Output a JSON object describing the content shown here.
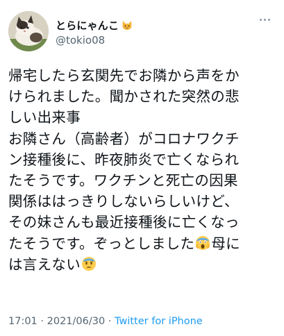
{
  "user": {
    "display_name": "とらにゃんこ",
    "handle": "@tokio08",
    "badge_icon": "cat-face-emoji",
    "avatar": "cat-photo-avatar"
  },
  "more_icon": "more-horizontal-icon",
  "tweet": {
    "lines": [
      "帰宅したら玄関先でお隣から声をか",
      "けられました。聞かされた突然の悲",
      "しい出来事",
      "お隣さん（高齢者）がコロナワクチ",
      "ン接種後に、昨夜肺炎で亡くなられ",
      "たそうです。ワクチンと死亡の因果",
      "関係ははっきりしないらしいけど、",
      "その妹さんも最近接種後に亡くなっ"
    ],
    "line9_text": "たそうです。ぞっとしました",
    "line9_emoji": "screaming-face-emoji",
    "line9_tail": "母に",
    "line10_text": "は言えない",
    "line10_emoji": "fearful-face-emoji"
  },
  "meta": {
    "time": "17:01",
    "date": "2021/06/30",
    "separator": " · ",
    "source": "Twitter for iPhone"
  },
  "colors": {
    "text": "#0f1419",
    "secondary": "#536471",
    "link": "#1d9bf0"
  }
}
